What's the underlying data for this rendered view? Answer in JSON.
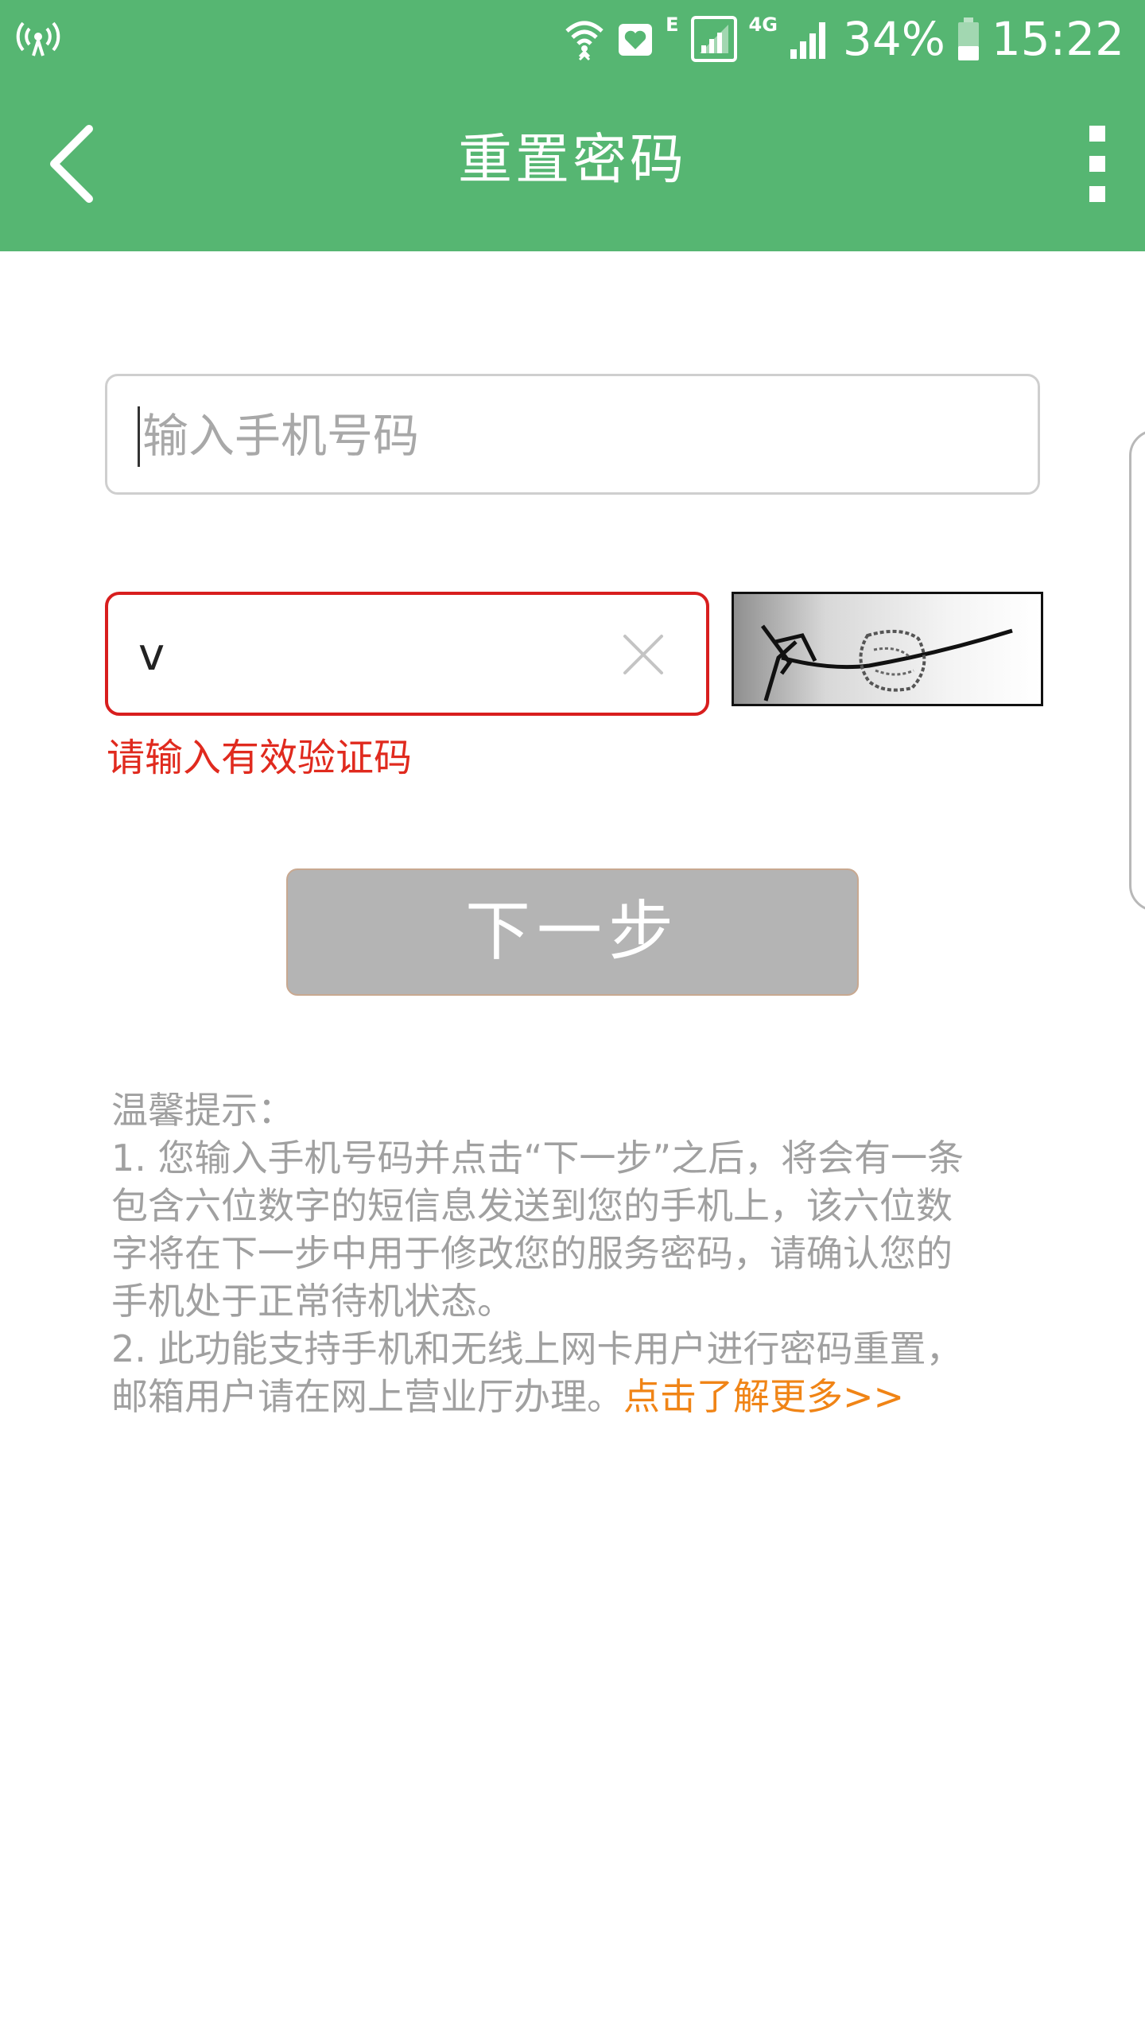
{
  "status_bar": {
    "network_type": "E",
    "lte_label": "4G",
    "battery": "34%",
    "time": "15:22",
    "icons": [
      "hotspot-icon",
      "wifi-icon",
      "notification-icon",
      "sim-signal-icon",
      "signal-icon",
      "battery-icon"
    ]
  },
  "app_bar": {
    "title": "重置密码",
    "back_icon": "chevron-left-icon",
    "menu_icon": "more-vertical-icon"
  },
  "form": {
    "phone_placeholder": "输入手机号码",
    "phone_value": "",
    "code_value": "v",
    "clear_icon": "close-icon",
    "error": "请输入有效验证码",
    "next_label": "下一步"
  },
  "tips": {
    "heading": "温馨提示：",
    "lines": [
      "1. 您输入手机号码并点击“下一步”之后，将会有一条",
      "包含六位数字的短信息发送到您的手机上，该六位数",
      "字将在下一步中用于修改您的服务密码，请确认您的",
      "手机处于正常待机状态。",
      "2. 此功能支持手机和无线上网卡用户进行密码重置，"
    ],
    "last_line": "邮箱用户请在网上营业厅办理。",
    "link": "点击了解更多>>"
  },
  "colors": {
    "primary": "#56b672",
    "error": "#e02a1e",
    "link": "#f08416",
    "button_disabled": "#b4b4b4"
  }
}
